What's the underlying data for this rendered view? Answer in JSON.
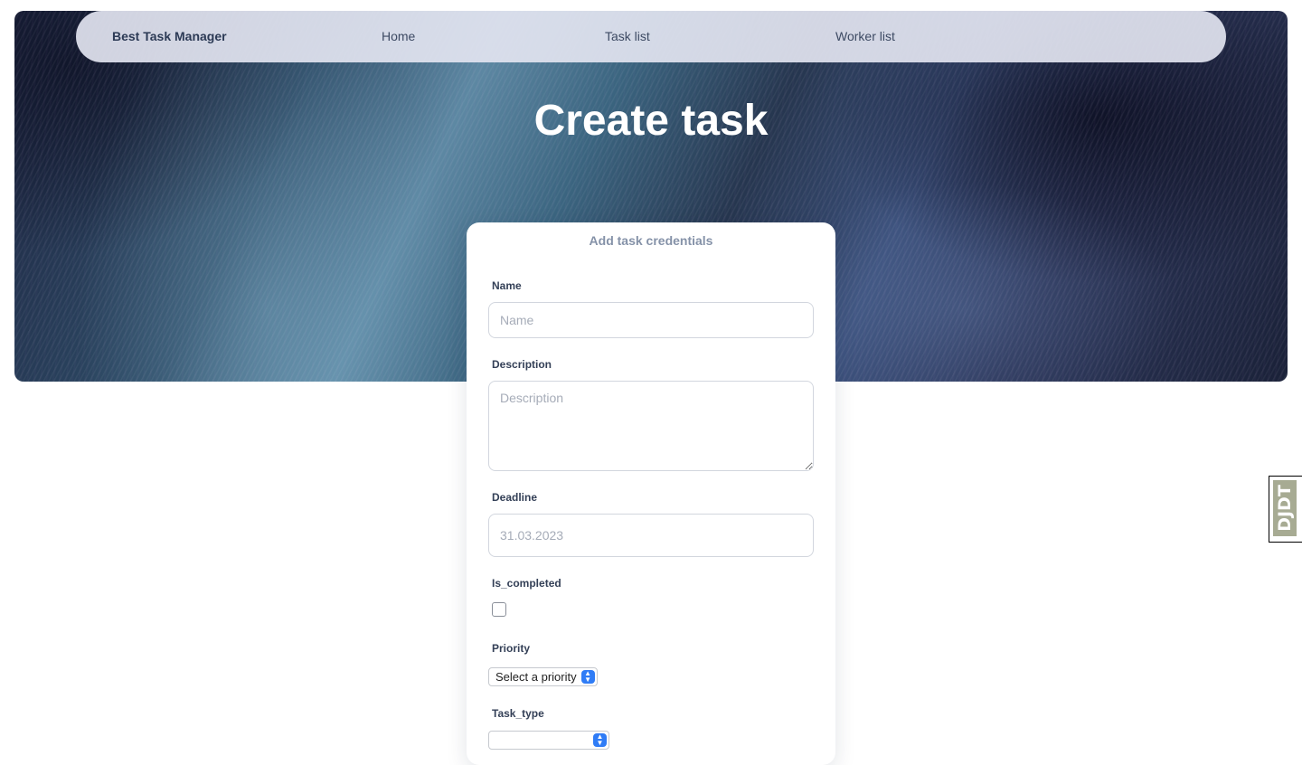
{
  "nav": {
    "brand": "Best Task Manager",
    "items": [
      {
        "label": "Home"
      },
      {
        "label": "Task list"
      },
      {
        "label": "Worker list"
      }
    ]
  },
  "page": {
    "title": "Create task"
  },
  "form": {
    "heading": "Add task credentials",
    "name": {
      "label": "Name",
      "placeholder": "Name",
      "value": ""
    },
    "description": {
      "label": "Description",
      "placeholder": "Description",
      "value": ""
    },
    "deadline": {
      "label": "Deadline",
      "value": "31.03.2023"
    },
    "is_completed": {
      "label": "Is_completed",
      "checked": false
    },
    "priority": {
      "label": "Priority",
      "selected": "Select a priority"
    },
    "task_type": {
      "label": "Task_type",
      "selected": ""
    }
  },
  "debug_toolbar": {
    "label": "DJDT"
  },
  "colors": {
    "accent": "#2f7cf6",
    "navbar": "#e2e4f0",
    "title_text": "#ffffff"
  }
}
